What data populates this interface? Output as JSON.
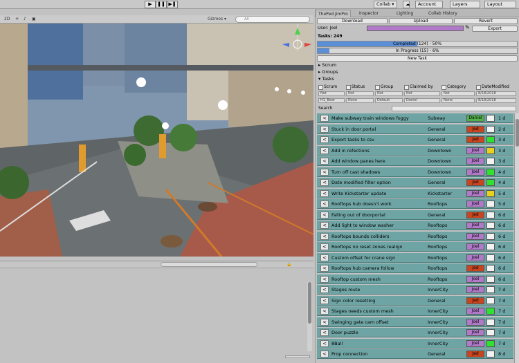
{
  "toolbar": {
    "play_icons": [
      "▶",
      "❚❚",
      "▶❚"
    ],
    "collab": "Collab ▾",
    "account": "Account",
    "layers": "Layers",
    "layout": "Layout"
  },
  "scene_toolbar": {
    "mode_2d": "2D",
    "gizmos": "Gizmos ▾",
    "search_placeholder": "All"
  },
  "right_panel": {
    "tabs": [
      "ThePed.JimPro",
      "Inspector",
      "Lighting",
      "Collab History"
    ],
    "download_label": "Download",
    "upload_label": "Upload",
    "revert_label": "Revert",
    "user_label": "User: Joel",
    "export_label": "Export",
    "tasks_label": "Tasks: 249",
    "completed": {
      "text": "Completed (124) - 50%",
      "fraction": 0.5
    },
    "in_progress": {
      "text": "In Progress (15) - 6%",
      "fraction": 0.06
    },
    "new_task_label": "New Task",
    "foldouts": [
      "Scrum",
      "Groups",
      "Tasks"
    ],
    "filter_headers": [
      "Scrum",
      "Status",
      "Group",
      "Claimed by",
      "Category",
      "DateModified"
    ],
    "filter_not": [
      "Not",
      "Not",
      "Not",
      "Not",
      "Not",
      "8/18/2018"
    ],
    "filter_values": [
      "H1_Bear",
      "None",
      "Default",
      "Daniel",
      "None",
      "8/18/2018"
    ],
    "search_label": "Search"
  },
  "tasks": [
    {
      "name": "Make subway train windows foggy",
      "category": "Subway",
      "user": "Daniel",
      "user_color": "#52b24a",
      "status_color": "#f2f2f2",
      "days": "1 d"
    },
    {
      "name": "Stuck in door portal",
      "category": "General",
      "user": "Jed",
      "user_color": "#c8451f",
      "status_color": "#f2f2f2",
      "days": "2 d"
    },
    {
      "name": "Export tasks to csv",
      "category": "General",
      "user": "Jed",
      "user_color": "#c8451f",
      "status_color": "#2ee22e",
      "days": "3 d"
    },
    {
      "name": "Add in refections",
      "category": "Downtown",
      "user": "Joel",
      "user_color": "#b07ac8",
      "status_color": "#e8d21e",
      "days": "3 d"
    },
    {
      "name": "Add window panes here",
      "category": "Downtown",
      "user": "Joel",
      "user_color": "#b07ac8",
      "status_color": "#f2f2f2",
      "days": "3 d"
    },
    {
      "name": "Turn off cast shadows",
      "category": "Downtown",
      "user": "Joel",
      "user_color": "#b07ac8",
      "status_color": "#2ee22e",
      "days": "4 d"
    },
    {
      "name": "Date modified filter option",
      "category": "General",
      "user": "Jed",
      "user_color": "#c8451f",
      "status_color": "#2ee22e",
      "days": "4 d"
    },
    {
      "name": "Write Kickstarter update",
      "category": "Kickstarter",
      "user": "Joel",
      "user_color": "#b07ac8",
      "status_color": "#e8d21e",
      "days": "5 d"
    },
    {
      "name": "Rooftops hub doesn't work",
      "category": "Rooftops",
      "user": "Joel",
      "user_color": "#b07ac8",
      "status_color": "#f2f2f2",
      "days": "5 d"
    },
    {
      "name": "Falling out of doorportal",
      "category": "General",
      "user": "Jed",
      "user_color": "#c8451f",
      "status_color": "#f2f2f2",
      "days": "6 d"
    },
    {
      "name": "Add light to window washer",
      "category": "Rooftops",
      "user": "Joel",
      "user_color": "#b07ac8",
      "status_color": "#f2f2f2",
      "days": "6 d"
    },
    {
      "name": "Rooftops bounds colliders",
      "category": "Rooftops",
      "user": "Joel",
      "user_color": "#b07ac8",
      "status_color": "#f2f2f2",
      "days": "6 d"
    },
    {
      "name": "Rooftops no reset zones realign",
      "category": "Rooftops",
      "user": "Joel",
      "user_color": "#b07ac8",
      "status_color": "#f2f2f2",
      "days": "6 d"
    },
    {
      "name": "Custom offset for crane sign",
      "category": "Rooftops",
      "user": "Joel",
      "user_color": "#b07ac8",
      "status_color": "#f2f2f2",
      "days": "6 d"
    },
    {
      "name": "Rooftops hub camera follow",
      "category": "Rooftops",
      "user": "Jed",
      "user_color": "#c8451f",
      "status_color": "#f2f2f2",
      "days": "6 d"
    },
    {
      "name": "Rooftop custom mesh",
      "category": "Rooftops",
      "user": "Joel",
      "user_color": "#b07ac8",
      "status_color": "#f2f2f2",
      "days": "6 d"
    },
    {
      "name": "Stages route",
      "category": "InnerCity",
      "user": "Joel",
      "user_color": "#b07ac8",
      "status_color": "#f2f2f2",
      "days": "7 d"
    },
    {
      "name": "Sign color resetting",
      "category": "General",
      "user": "Jed",
      "user_color": "#c8451f",
      "status_color": "#f2f2f2",
      "days": "7 d"
    },
    {
      "name": "Stages needs custom mesh",
      "category": "InnerCity",
      "user": "Joel",
      "user_color": "#b07ac8",
      "status_color": "#2ee22e",
      "days": "7 d"
    },
    {
      "name": "Swinging gate cam offset",
      "category": "InnerCity",
      "user": "Joel",
      "user_color": "#b07ac8",
      "status_color": "#f2f2f2",
      "days": "7 d"
    },
    {
      "name": "Door puzzle",
      "category": "InnerCity",
      "user": "Joel",
      "user_color": "#b07ac8",
      "status_color": "#f2f2f2",
      "days": "7 d"
    },
    {
      "name": "8Ball",
      "category": "InnerCity",
      "user": "Joel",
      "user_color": "#b07ac8",
      "status_color": "#2ee22e",
      "days": "7 d"
    },
    {
      "name": "Prop connection",
      "category": "General",
      "user": "Jed",
      "user_color": "#c8451f",
      "status_color": "#f2f2f2",
      "days": "8 d"
    }
  ],
  "colors": {
    "row_bg": "#6fa4a4",
    "progress_fill": "#5a8fd8",
    "user_bar": "#b07ac8"
  }
}
